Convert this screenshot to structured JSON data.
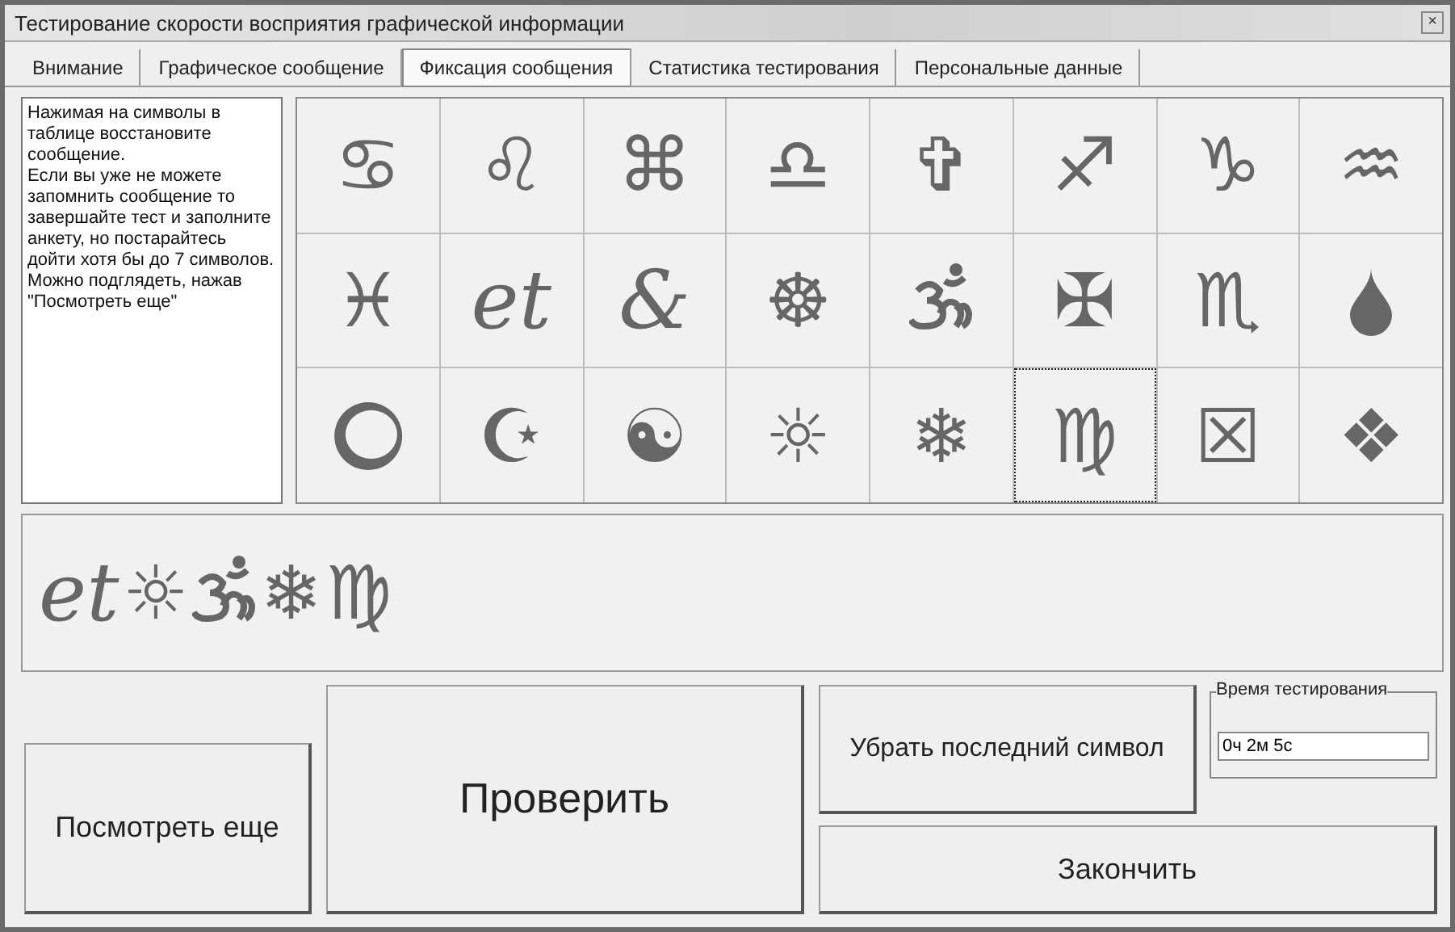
{
  "window": {
    "title": "Тестирование скорости восприятия графической информации",
    "close": "×"
  },
  "tabs": [
    {
      "label": "Внимание",
      "selected": false
    },
    {
      "label": "Графическое сообщение",
      "selected": false
    },
    {
      "label": "Фиксация сообщения",
      "selected": true
    },
    {
      "label": "Статистика тестирования",
      "selected": false
    },
    {
      "label": "Персональные данные",
      "selected": false
    }
  ],
  "instructions": [
    "Нажимая на символы в таблице восстановите сообщение.",
    "Если вы уже не можете запомнить сообщение то завершайте тест и заполните анкету, но постарайтесь дойти хотя бы до 7 символов.",
    "Можно подглядеть, нажав \"Посмотреть еще\""
  ],
  "symbols": [
    {
      "kind": "glyph",
      "glyph": "♋",
      "selected": false
    },
    {
      "kind": "glyph",
      "glyph": "♌",
      "selected": false
    },
    {
      "kind": "glyph",
      "glyph": "⌘",
      "selected": false
    },
    {
      "kind": "glyph",
      "glyph": "♎",
      "selected": false
    },
    {
      "kind": "glyph",
      "glyph": "✞",
      "selected": false
    },
    {
      "kind": "glyph",
      "glyph": "♐",
      "selected": false
    },
    {
      "kind": "glyph",
      "glyph": "♑",
      "selected": false
    },
    {
      "kind": "glyph",
      "glyph": "♒",
      "selected": false
    },
    {
      "kind": "glyph",
      "glyph": "♓",
      "selected": false
    },
    {
      "kind": "script",
      "glyph": "et",
      "selected": false
    },
    {
      "kind": "script",
      "glyph": "&",
      "selected": false
    },
    {
      "kind": "glyph",
      "glyph": "☸",
      "selected": false
    },
    {
      "kind": "om",
      "selected": false
    },
    {
      "kind": "glyph",
      "glyph": "✠",
      "selected": false
    },
    {
      "kind": "glyph",
      "glyph": "♏",
      "selected": false
    },
    {
      "kind": "drop",
      "selected": false
    },
    {
      "kind": "ring",
      "selected": false
    },
    {
      "kind": "glyph",
      "glyph": "☪",
      "selected": false
    },
    {
      "kind": "glyph",
      "glyph": "☯",
      "selected": false
    },
    {
      "kind": "glyph",
      "glyph": "☼",
      "selected": false
    },
    {
      "kind": "glyph",
      "glyph": "❄",
      "selected": false
    },
    {
      "kind": "glyph",
      "glyph": "♍",
      "selected": true
    },
    {
      "kind": "glyph",
      "glyph": "☒",
      "selected": false
    },
    {
      "kind": "glyph",
      "glyph": "❖",
      "selected": false
    }
  ],
  "message": [
    {
      "kind": "script",
      "glyph": "et"
    },
    {
      "kind": "glyph",
      "glyph": "☼"
    },
    {
      "kind": "om"
    },
    {
      "kind": "glyph",
      "glyph": "❄"
    },
    {
      "kind": "glyph",
      "glyph": "♍"
    }
  ],
  "buttons": {
    "peek": "Посмотреть еще",
    "check": "Проверить",
    "remove_last": "Убрать последний символ",
    "finish": "Закончить"
  },
  "timer": {
    "label": "Время тестирования",
    "value": "0ч 2м 5с"
  }
}
